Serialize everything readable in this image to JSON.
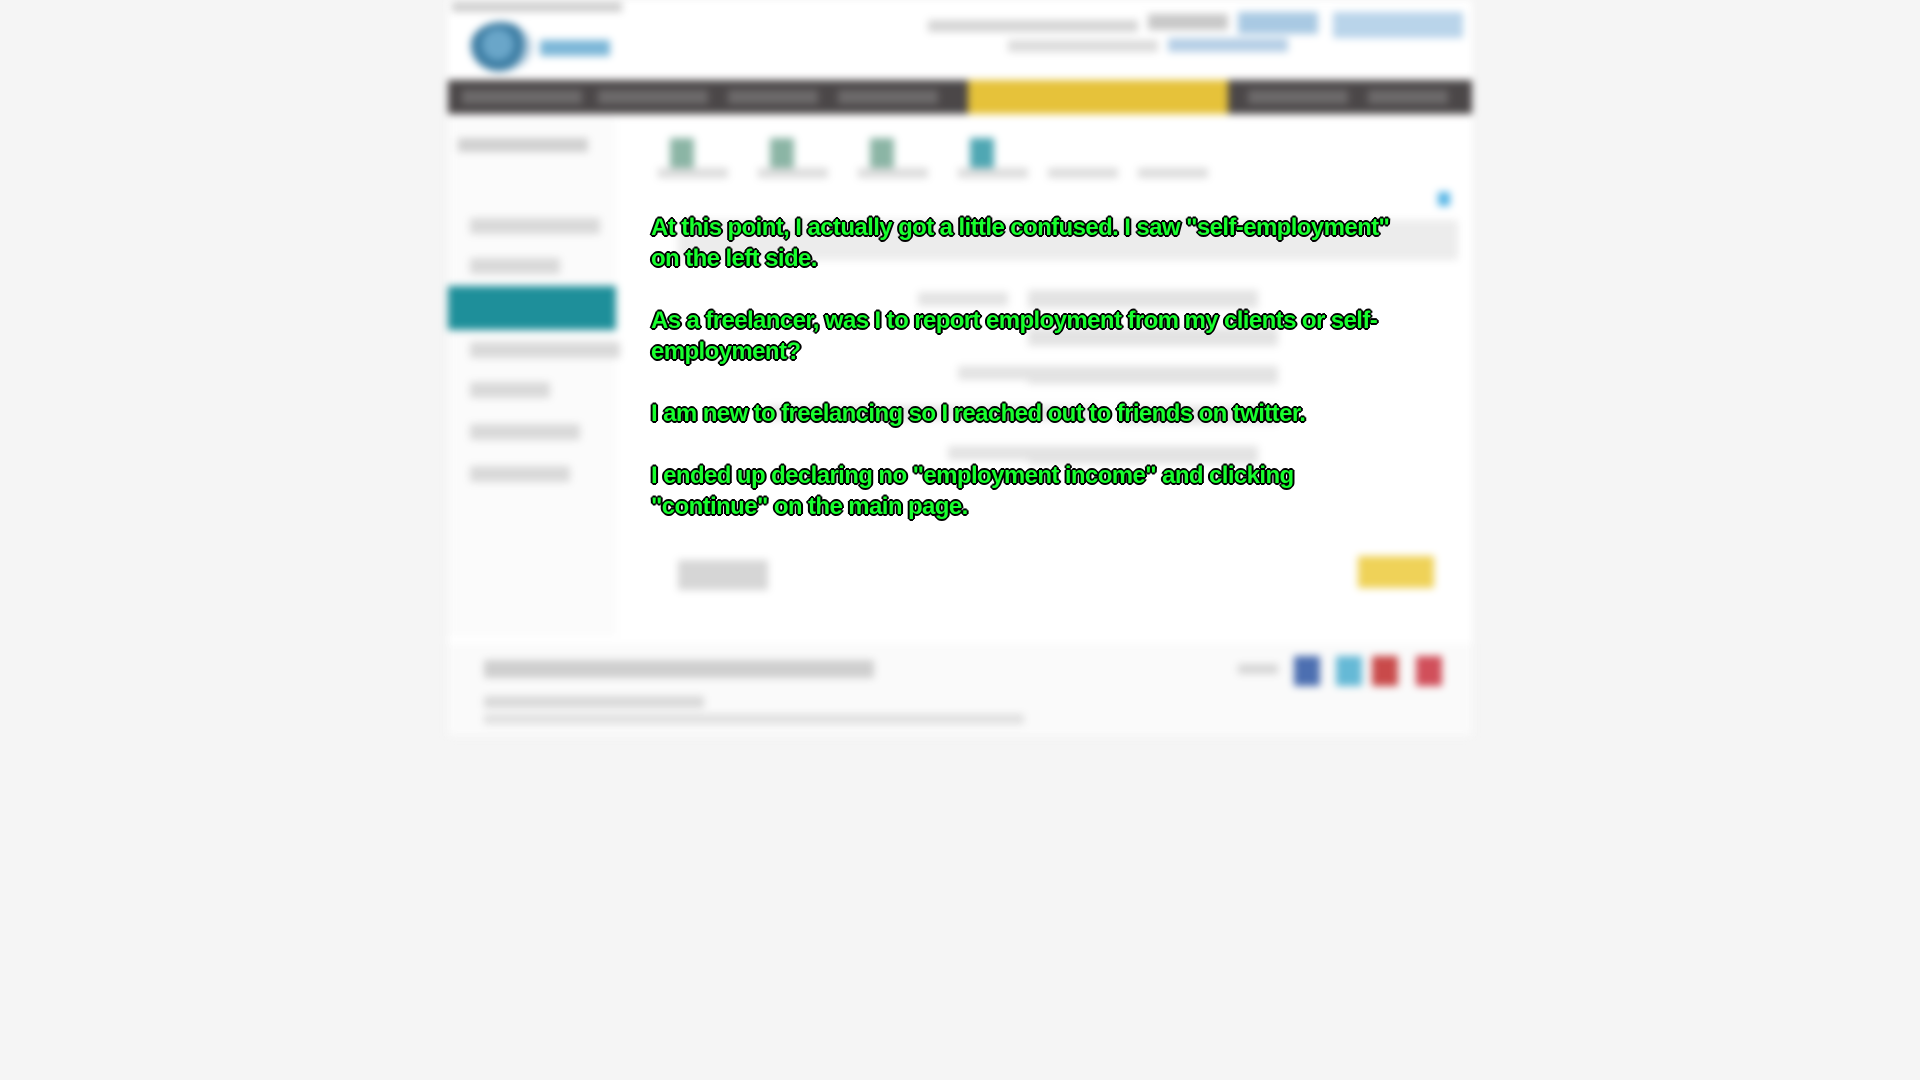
{
  "annotation": {
    "p1": "At this point, I actually got a little confused. I saw \"self-employment\" on the left side.",
    "p2": "As a freelancer, was I to report employment from my clients or self-employment?",
    "p3": "I am new to freelancing so I reached out to friends on twitter.",
    "p4": "I ended up declaring no \"employment income\" and clicking \"continue\" on the main page."
  },
  "colors": {
    "annotation_text": "#18ff2e",
    "nav_bar": "#4b4748",
    "nav_highlight": "#e6c23a",
    "sidebar_active": "#1e8f9a",
    "continue_button": "#efd258"
  },
  "icons": [
    "logo-icon",
    "info-icon",
    "facebook-icon",
    "twitter-icon",
    "pinterest-icon",
    "youtube-icon"
  ]
}
